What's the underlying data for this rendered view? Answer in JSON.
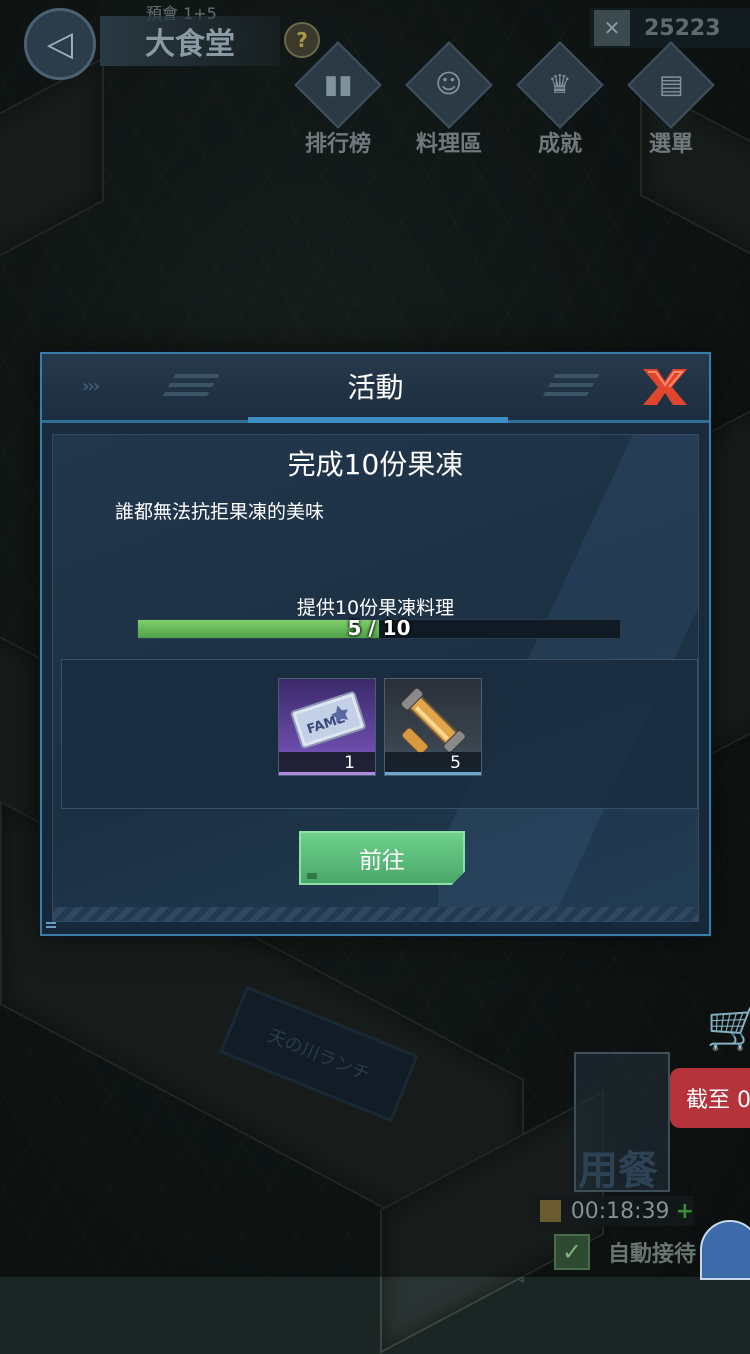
{
  "hud": {
    "hall_title": "大食堂",
    "sub_title": "預會 1+5",
    "help_label": "?",
    "currency_value": "25223",
    "nav": [
      {
        "label": "排行榜",
        "icon": "leaderboard-icon",
        "glyph": "▮▮"
      },
      {
        "label": "料理區",
        "icon": "chef-icon",
        "glyph": "☺"
      },
      {
        "label": "成就",
        "icon": "trophy-icon",
        "glyph": "♛"
      },
      {
        "label": "選單",
        "icon": "menu-book-icon",
        "glyph": "▤"
      }
    ]
  },
  "dialog": {
    "title": "活動",
    "task_title": "完成10份果凍",
    "description": "誰都無法抗拒果凍的美味",
    "requirement": "提供10份果凍料理",
    "progress": {
      "current": 5,
      "total": 10,
      "text": "5 / 10"
    },
    "rewards": [
      {
        "name": "fame-ticket",
        "icon_text": "FAME",
        "count": "1",
        "rarity": "epic"
      },
      {
        "name": "material-tube",
        "icon_text": "",
        "count": "5",
        "rarity": "rare"
      }
    ],
    "go_button": "前往"
  },
  "overlay": {
    "deadline_badge": "截至 0",
    "dine_label": "用餐",
    "timer": "00:18:39",
    "timer_plus": "+",
    "auto_reception": "自動接待",
    "shop_sign": "天の川ランチ"
  }
}
